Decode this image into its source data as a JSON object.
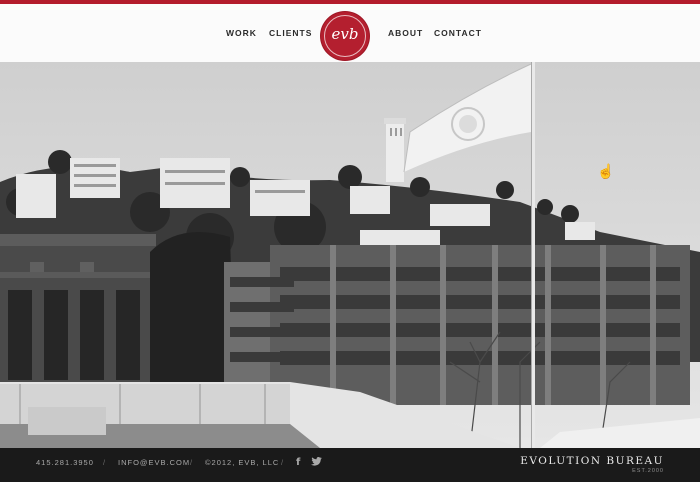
{
  "nav": {
    "work": "WORK",
    "clients": "CLIENTS",
    "about": "ABOUT",
    "contact": "CONTACT",
    "logo_text": "evb"
  },
  "footer": {
    "phone": "415.281.3950",
    "email": "INFO@EVB.COM",
    "copyright": "©2012, EVB, LLC",
    "separator": "/",
    "brand": "EVOLUTION BUREAU",
    "est": "EST.2000",
    "icons": [
      "facebook-icon",
      "twitter-icon"
    ]
  },
  "colors": {
    "accent": "#b31b2c",
    "footer_bg": "#1a1a1a"
  }
}
